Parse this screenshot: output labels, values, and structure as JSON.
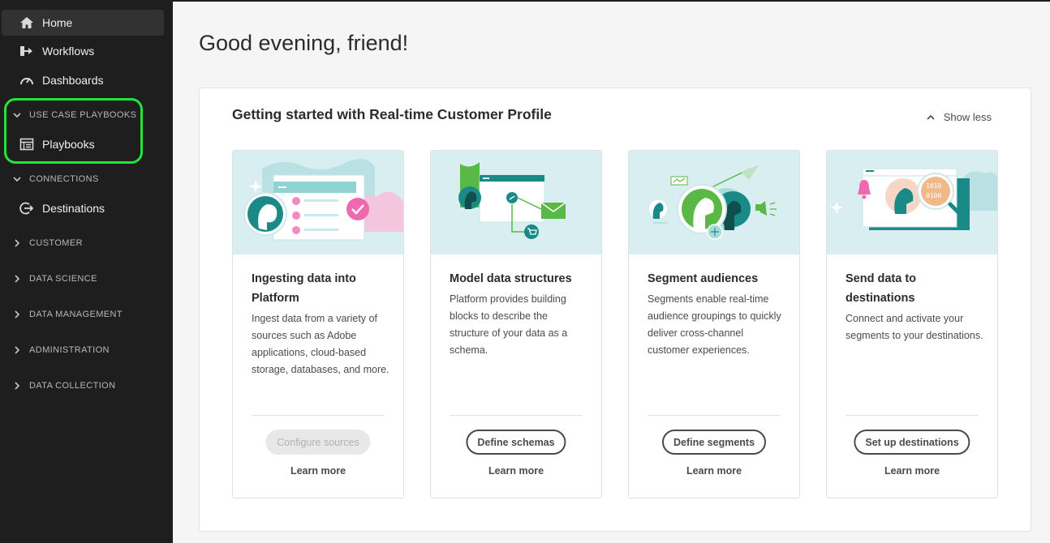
{
  "sidebar": {
    "home": "Home",
    "workflows": "Workflows",
    "dashboards": "Dashboards",
    "sections": {
      "use_case_playbooks": "USE CASE PLAYBOOKS",
      "connections": "CONNECTIONS",
      "customer": "CUSTOMER",
      "data_science": "DATA SCIENCE",
      "data_management": "DATA MANAGEMENT",
      "administration": "ADMINISTRATION",
      "data_collection": "DATA COLLECTION"
    },
    "playbooks": "Playbooks",
    "destinations": "Destinations",
    "highlight_color": "#22e53a"
  },
  "main": {
    "greeting": "Good evening, friend!",
    "panel_title": "Getting started with Real-time Customer Profile",
    "show_less": "Show less"
  },
  "cards": [
    {
      "title": "Ingesting data into Platform",
      "description": "Ingest data from a variety of sources such as Adobe applications, cloud-based storage, databases, and more.",
      "button": "Configure sources",
      "button_disabled": true,
      "learn_more": "Learn more"
    },
    {
      "title": "Model data structures",
      "description": "Platform provides building blocks to describe the structure of your data as a schema.",
      "button": "Define schemas",
      "button_disabled": false,
      "learn_more": "Learn more"
    },
    {
      "title": "Segment audiences",
      "description": "Segments enable real-time audience groupings to quickly deliver cross-channel customer experiences.",
      "button": "Define segments",
      "button_disabled": false,
      "learn_more": "Learn more"
    },
    {
      "title": "Send data to destinations",
      "description": "Connect and activate your segments to your destinations.",
      "button": "Set up destinations",
      "button_disabled": false,
      "learn_more": "Learn more"
    }
  ],
  "colors": {
    "sidebar_bg": "#1e1e1e",
    "teal": "#1a8a87",
    "green": "#5ab946",
    "pink": "#f4b6d6",
    "illus_bg": "#d9eef0"
  }
}
